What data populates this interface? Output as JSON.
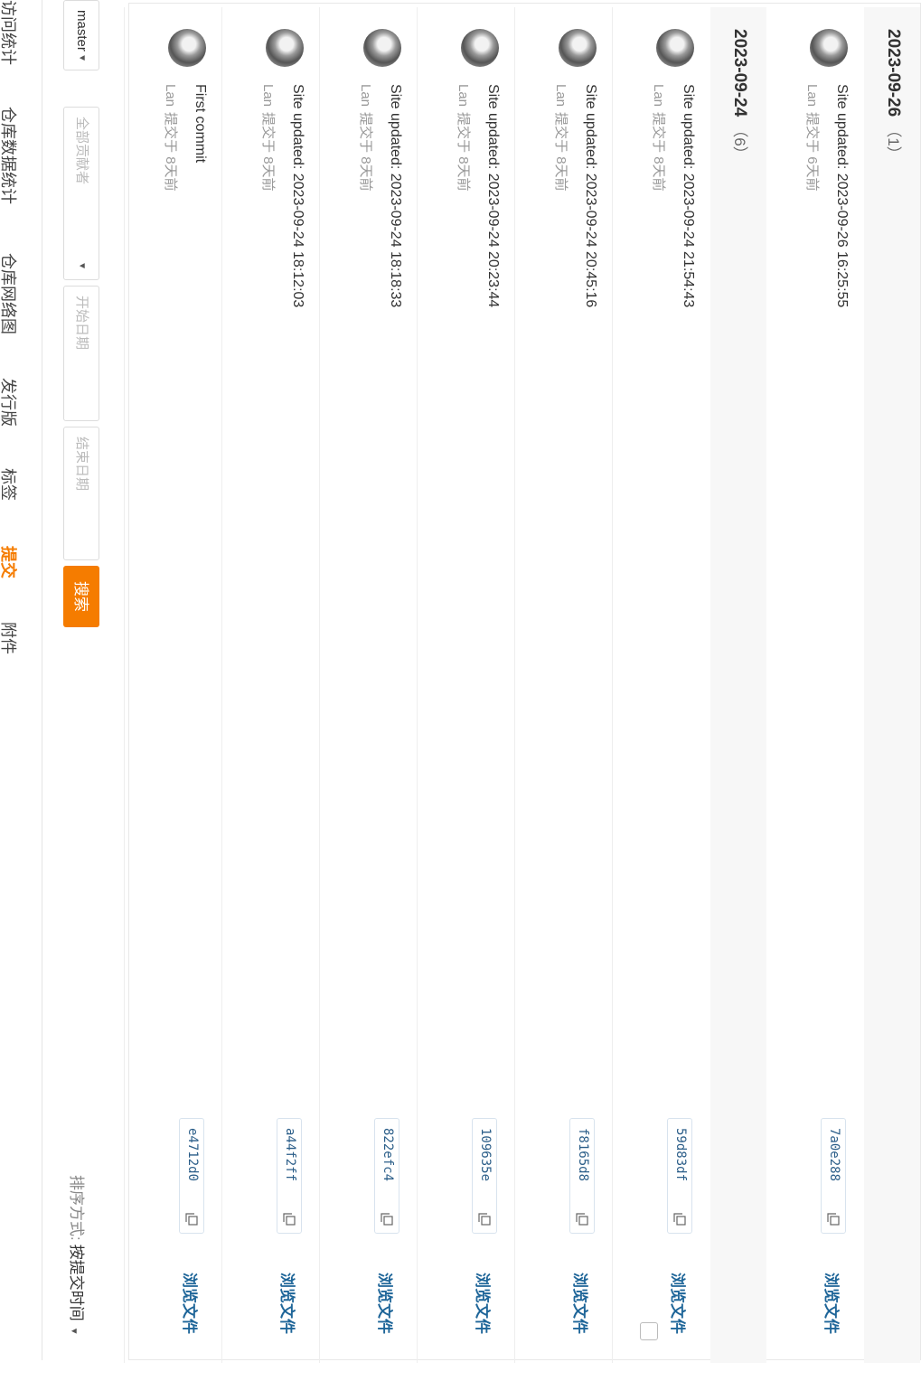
{
  "tabs": [
    {
      "label": "访问统计",
      "active": false
    },
    {
      "label": "仓库数据统计",
      "active": false
    },
    {
      "label": "仓库网络图",
      "active": false
    },
    {
      "label": "发行版",
      "active": false
    },
    {
      "label": "标签",
      "active": false
    },
    {
      "label": "提交",
      "active": true
    },
    {
      "label": "附件",
      "active": false
    }
  ],
  "filters": {
    "branch": "master",
    "contributor_placeholder": "全部贡献者",
    "start_date_placeholder": "开始日期",
    "end_date_placeholder": "结束日期",
    "search_label": "搜索"
  },
  "sort": {
    "label": "排序方式:",
    "value": "按提交时间"
  },
  "accent_color": "#f57c00",
  "groups": [
    {
      "date": "2023-09-26",
      "count": "（1）",
      "commits": [
        {
          "message": "Site updated: 2023-09-26 16:25:55",
          "author": "Lan",
          "committed": "提交于 6天前",
          "sha": "7a0e288",
          "browse": "浏览文件"
        }
      ]
    },
    {
      "date": "2023-09-24",
      "count": "（6）",
      "commits": [
        {
          "message": "Site updated: 2023-09-24 21:54:43",
          "author": "Lan",
          "committed": "提交于 8天前",
          "sha": "59d83df",
          "browse": "浏览文件"
        },
        {
          "message": "Site updated: 2023-09-24 20:45:16",
          "author": "Lan",
          "committed": "提交于 8天前",
          "sha": "f8165d8",
          "browse": "浏览文件"
        },
        {
          "message": "Site updated: 2023-09-24 20:23:44",
          "author": "Lan",
          "committed": "提交于 8天前",
          "sha": "109635e",
          "browse": "浏览文件"
        },
        {
          "message": "Site updated: 2023-09-24 18:18:33",
          "author": "Lan",
          "committed": "提交于 8天前",
          "sha": "822efc4",
          "browse": "浏览文件"
        },
        {
          "message": "Site updated: 2023-09-24 18:12:03",
          "author": "Lan",
          "committed": "提交于 8天前",
          "sha": "a44f2ff",
          "browse": "浏览文件"
        },
        {
          "message": "First commit",
          "author": "Lan",
          "committed": "提交于 8天前",
          "sha": "e4712d0",
          "browse": "浏览文件"
        }
      ]
    }
  ]
}
